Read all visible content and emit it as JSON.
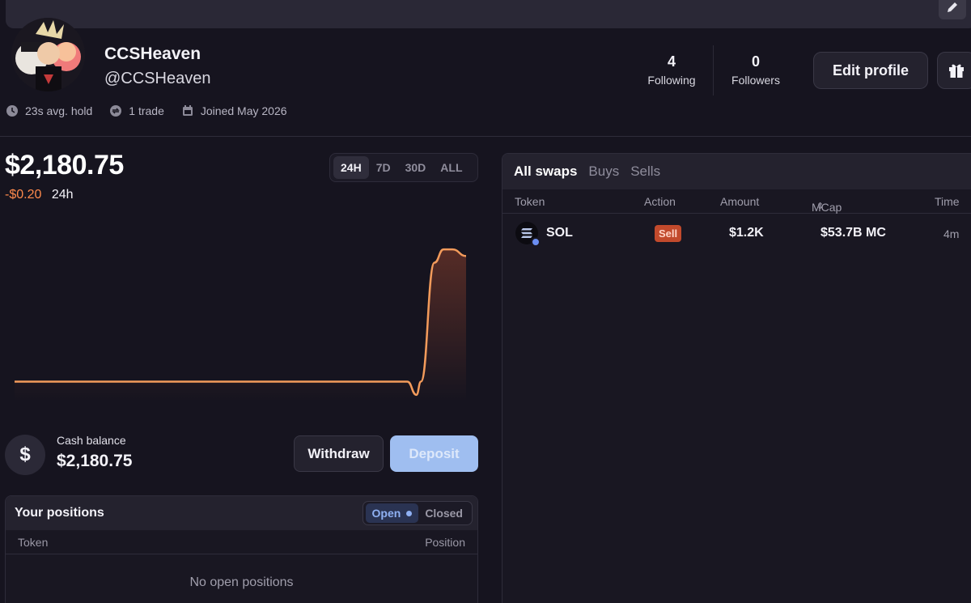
{
  "profile": {
    "username": "CCSHeaven",
    "handle": "@CCSHeaven",
    "avg_hold": "23s avg. hold",
    "trades": "1 trade",
    "joined": "Joined May 2026",
    "following_count": "4",
    "following_label": "Following",
    "followers_count": "0",
    "followers_label": "Followers",
    "edit_profile_label": "Edit profile"
  },
  "portfolio": {
    "balance": "$2,180.75",
    "change": "-$0.20",
    "change_period": "24h",
    "ranges": [
      "24H",
      "7D",
      "30D",
      "ALL"
    ],
    "active_range": "24H"
  },
  "chart_data": {
    "type": "area",
    "x": [
      0,
      0.87,
      0.89,
      0.9,
      0.93,
      0.95,
      0.97,
      1.0
    ],
    "values": [
      2180.75,
      2180.75,
      2180.73,
      2180.75,
      2180.93,
      2180.95,
      2180.95,
      2180.94
    ],
    "line_color": "#f39b5b",
    "grid": false,
    "xlabel": "",
    "ylabel": ""
  },
  "cash": {
    "label": "Cash balance",
    "value": "$2,180.75",
    "icon": "$",
    "withdraw_label": "Withdraw",
    "deposit_label": "Deposit"
  },
  "positions": {
    "title": "Your positions",
    "open_label": "Open",
    "closed_label": "Closed",
    "col_token": "Token",
    "col_position": "Position",
    "empty": "No open positions"
  },
  "swaps": {
    "tabs": [
      "All swaps",
      "Buys",
      "Sells"
    ],
    "col_token": "Token",
    "col_action": "Action",
    "col_amount": "Amount",
    "col_mcap": "MCap",
    "col_mcap_sort": "⇕",
    "col_time": "Time",
    "rows": [
      {
        "token": "SOL",
        "action": "Sell",
        "amount": "$1.2K",
        "mcap": "$53.7B MC",
        "time": "4m"
      }
    ]
  },
  "colors": {
    "background": "#16141f",
    "accent_orange": "#ff8a4c",
    "deposit_blue": "#9fbef0",
    "sell_red": "#c24a2c"
  }
}
